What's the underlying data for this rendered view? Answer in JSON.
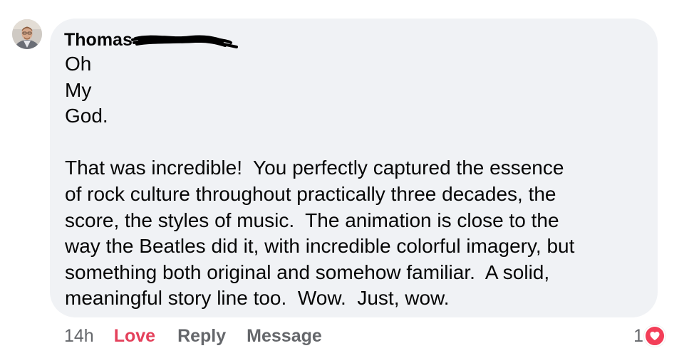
{
  "comment": {
    "author_name": "Thomas",
    "author_name_redacted": true,
    "lines": [
      "Oh",
      "My",
      "God.",
      "",
      "That was incredible!  You perfectly captured the essence",
      "of rock culture throughout practically three decades, the",
      "score, the styles of music.  The animation is close to the",
      "way the Beatles did it, with incredible colorful imagery, but",
      "something both original and somehow familiar.  A solid,",
      "meaningful story line too.  Wow.  Just, wow."
    ]
  },
  "actions": {
    "timestamp": "14h",
    "love_label": "Love",
    "reply_label": "Reply",
    "message_label": "Message"
  },
  "reactions": {
    "count": "1",
    "type": "heart-icon"
  },
  "colors": {
    "bubble": "#f0f2f5",
    "meta_text": "#65676b",
    "love": "#e4405b",
    "heart_badge": "#f33e58"
  }
}
